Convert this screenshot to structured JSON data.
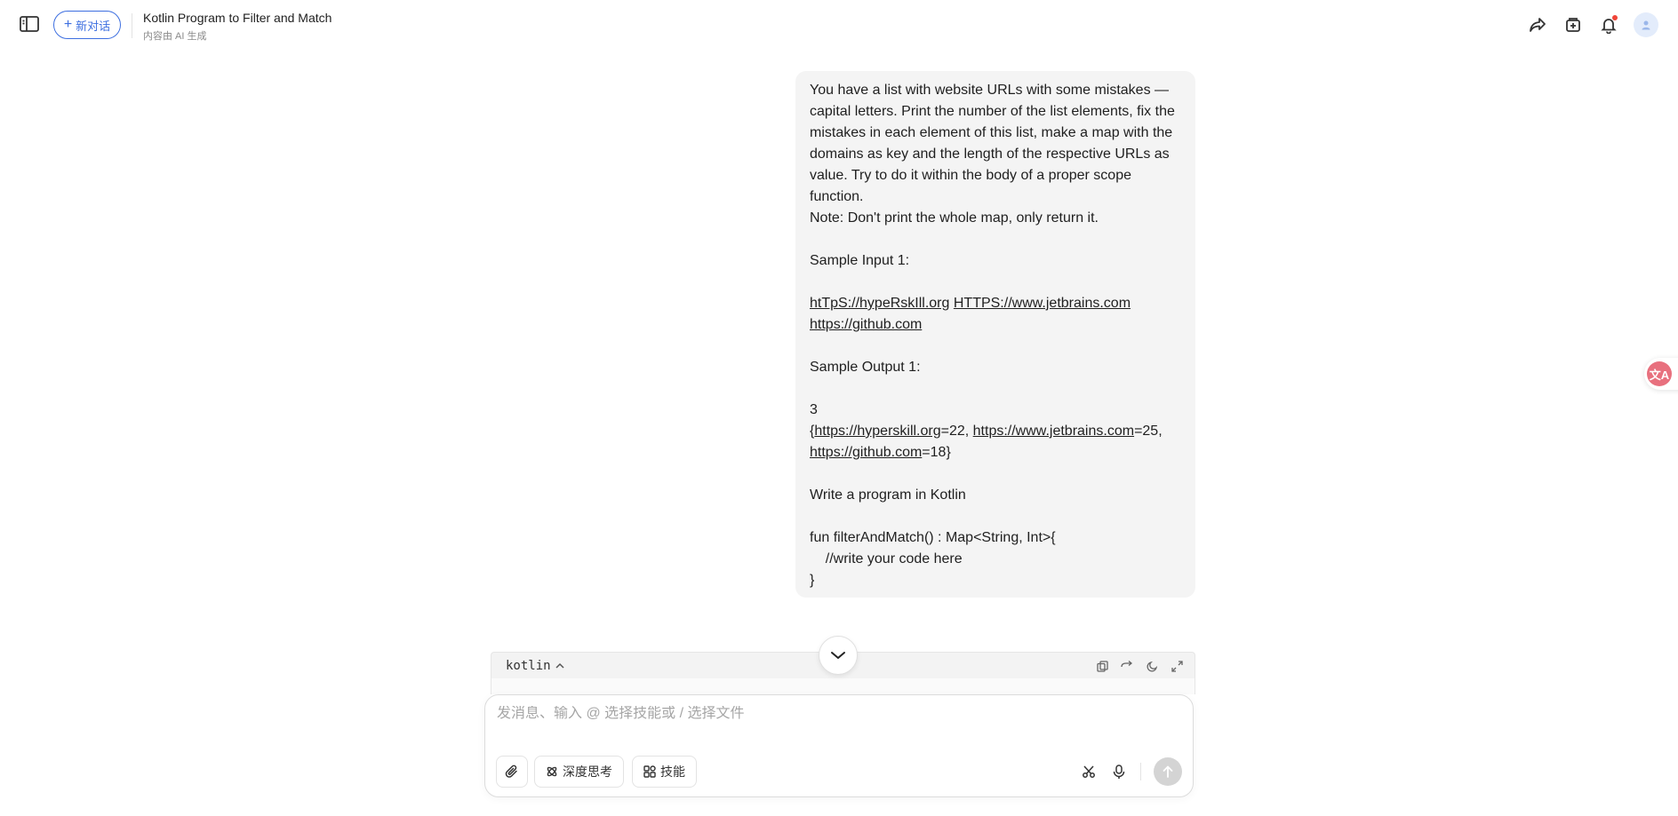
{
  "header": {
    "new_chat_label": "新对话",
    "title": "Kotlin Program to Filter and Match",
    "subtitle": "内容由 AI 生成"
  },
  "message": {
    "lines": [
      "You have a list with website URLs with some mistakes —",
      "capital letters. Print the number of the list elements, fix the",
      "mistakes in each element of this list, make a map with the",
      "domains as key and the length of the respective URLs as",
      "value. Try to do it within the body of a proper scope",
      "function.",
      "Note: Don't print the whole map, only return it.",
      "",
      "Sample Input 1:",
      ""
    ],
    "input_links_line1": [
      "htTpS://hypeRskIll.org",
      "HTTPS://www.jetbrains.com"
    ],
    "input_links_line2": "https://github.com",
    "sample_output_label": "Sample Output 1:",
    "output_count": "3",
    "output_map": {
      "open": "{",
      "link1": "https://hyperskill.org",
      "val1": "=22, ",
      "link2": "https://www.jetbrains.com",
      "val2": "=25,",
      "link3": "https://github.com",
      "val3": "=18}"
    },
    "write_program": "Write a program in Kotlin",
    "code_lines": [
      "fun filterAndMatch() : Map<String, Int>{",
      "    //write your code here",
      "}"
    ]
  },
  "code_block": {
    "language": "kotlin"
  },
  "composer": {
    "placeholder": "发消息、输入 @ 选择技能或 / 选择文件",
    "deep_think_label": "深度思考",
    "skills_label": "技能"
  },
  "translate_badge": "文A",
  "colors": {
    "accent": "#3d6fe0",
    "bubble_bg": "#f4f4f4",
    "notify_dot": "#f04438",
    "translate_badge": "#e8707e"
  }
}
